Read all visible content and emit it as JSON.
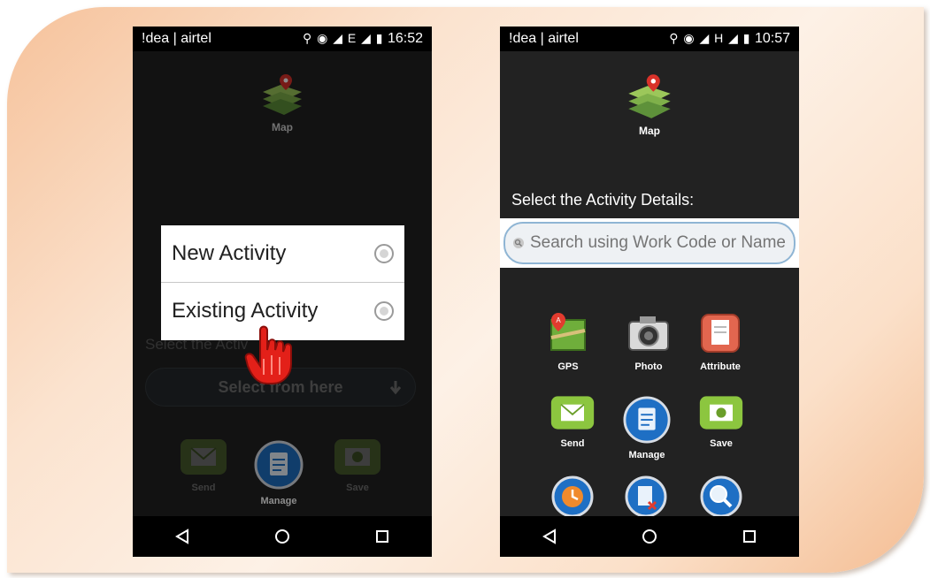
{
  "left_phone": {
    "status": {
      "carrier": "!dea | airtel",
      "icons": "⚲ ◉ ◢ E ◢ ▮",
      "time": "16:52"
    },
    "map_label": "Map",
    "dialog": {
      "options": [
        {
          "label": "New Activity"
        },
        {
          "label": "Existing Activity"
        }
      ]
    },
    "select_label": "Select the Activ",
    "select_button": "Select from here",
    "tiles": {
      "send": "Send",
      "manage": "Manage",
      "save": "Save"
    }
  },
  "right_phone": {
    "status": {
      "carrier": "!dea | airtel",
      "icons": "⚲ ◉ ◢ H ◢ ▮",
      "time": "10:57"
    },
    "map_label": "Map",
    "section_title": "Select the Activity Details:",
    "search_placeholder": "Search using Work Code or Name",
    "tiles": {
      "gps": "GPS",
      "photo": "Photo",
      "attribute": "Attribute",
      "send": "Send",
      "manage": "Manage",
      "save": "Save"
    }
  },
  "colors": {
    "accent_blue": "#1e6fc4",
    "green": "#8cc63f",
    "red": "#e23b2e",
    "background": "#222222"
  },
  "icons": [
    "map-icon",
    "radio-icon",
    "hand-pointer-icon",
    "gps-icon",
    "camera-icon",
    "attribute-icon",
    "send-icon",
    "manage-icon",
    "save-icon",
    "clock-icon",
    "delete-icon",
    "zoom-icon",
    "back-icon",
    "home-icon",
    "recents-icon"
  ]
}
